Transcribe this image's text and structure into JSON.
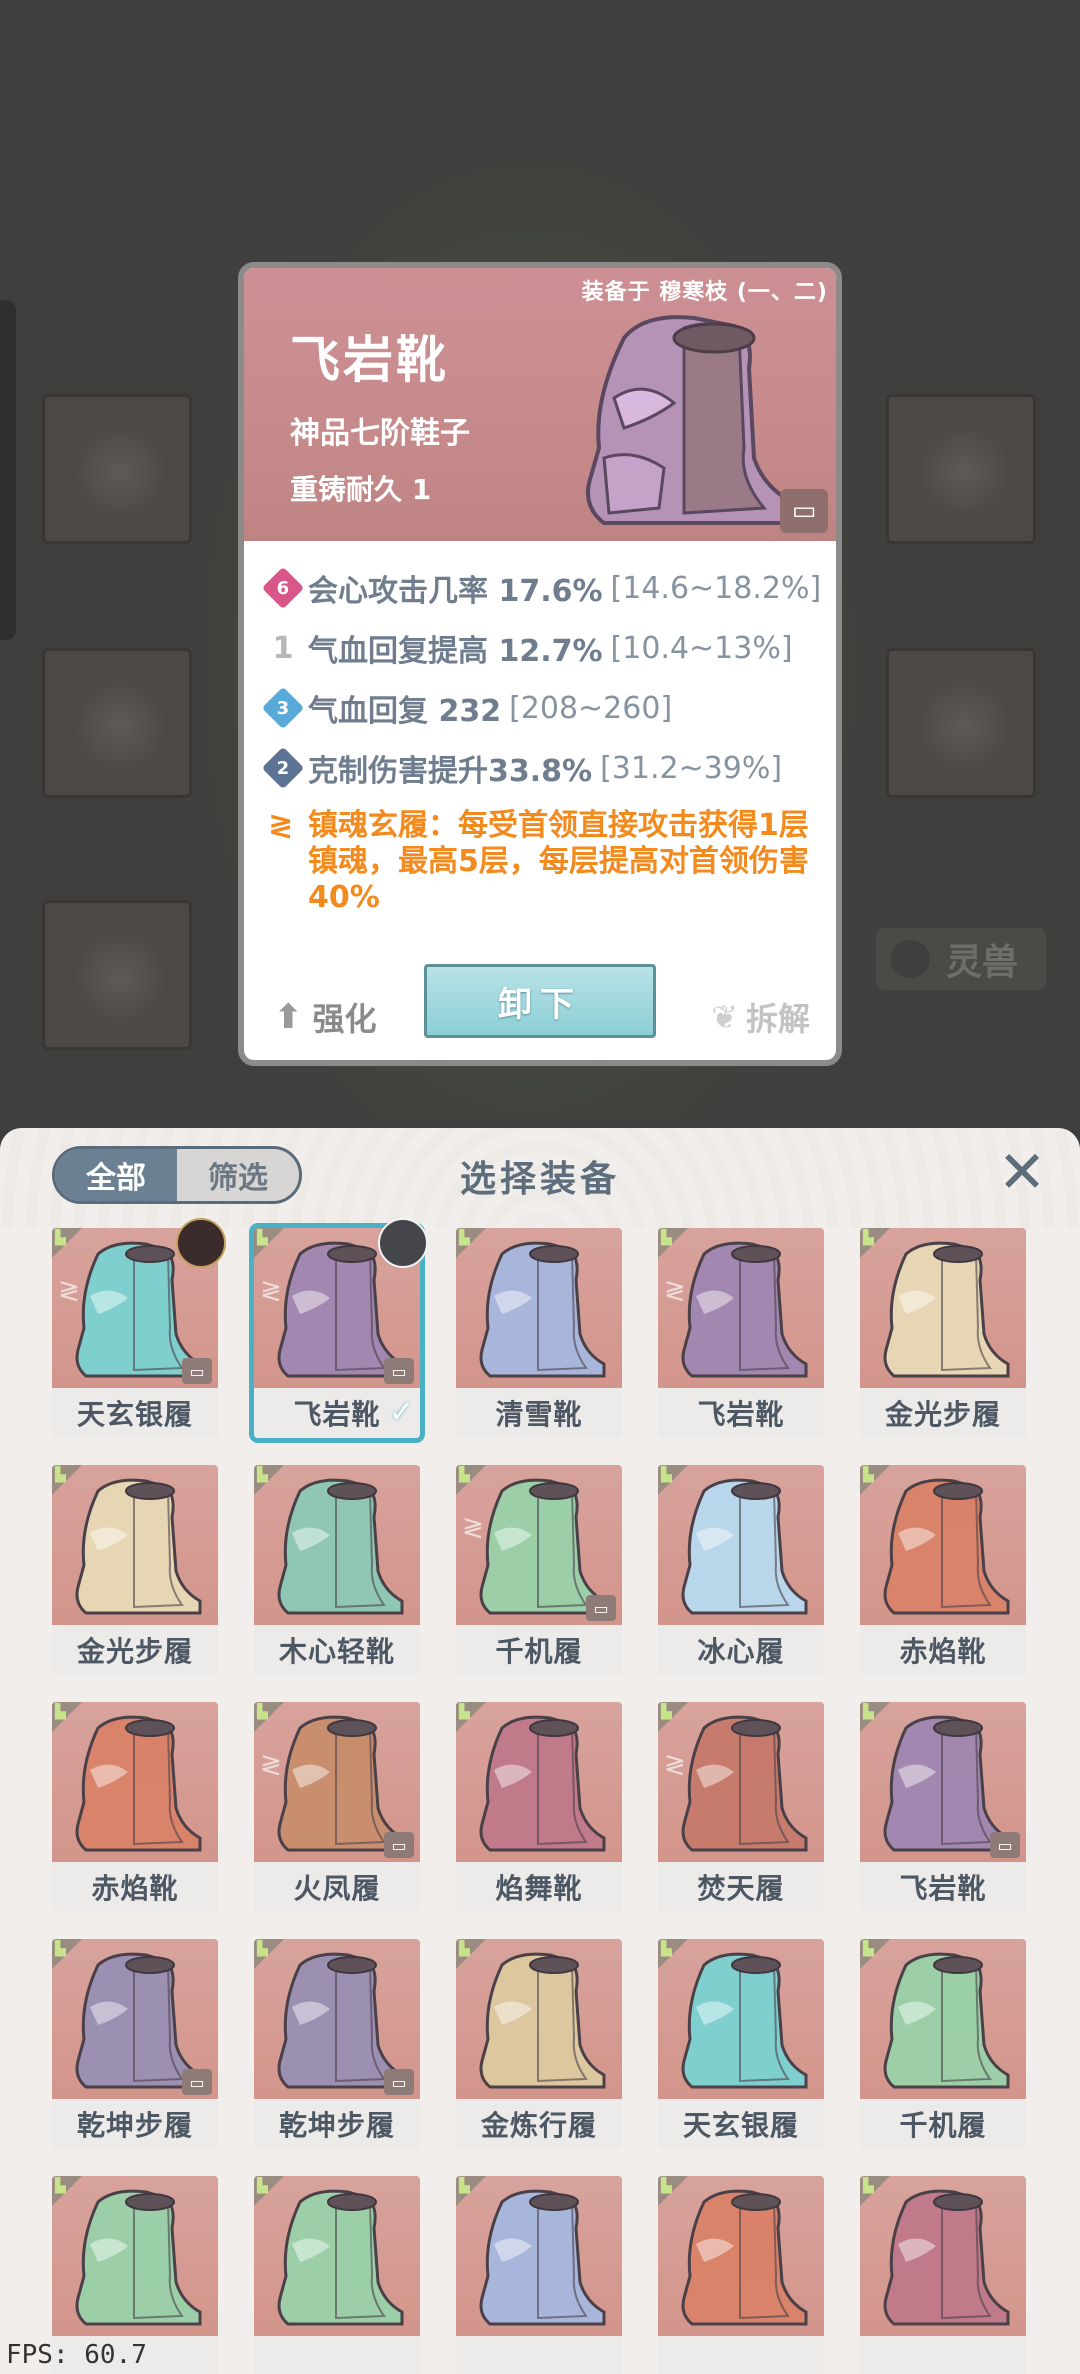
{
  "detail": {
    "equipped_by": "装备于 穆寒枝 (一、二)",
    "name": "飞岩靴",
    "grade": "神品七阶鞋子",
    "durability": "重铸耐久 1",
    "stats": [
      {
        "badge": "6",
        "gem": "pink",
        "label": "会心攻击几率 17.6%",
        "range": "[14.6~18.2%]"
      },
      {
        "badge": "1",
        "gem": "flame",
        "label": "气血回复提高 12.7%",
        "range": "[10.4~13%]"
      },
      {
        "badge": "3",
        "gem": "blue",
        "label": "气血回复 232",
        "range": "[208~260]"
      },
      {
        "badge": "2",
        "gem": "navy",
        "label": "克制伤害提升33.8%",
        "range": "[31.2~39%]"
      }
    ],
    "special": "镇魂玄履：每受首领直接攻击获得1层镇魂，最高5层，每层提高对首领伤害40%",
    "actions": {
      "upgrade": "强化",
      "remove": "卸下",
      "dismantle": "拆解"
    }
  },
  "background": {
    "pet_tab": "灵兽"
  },
  "panel": {
    "title": "选择装备",
    "filters": {
      "all": "全部",
      "filter": "筛选"
    },
    "items": [
      {
        "name": "天玄银履",
        "color": "#7fcfcf",
        "lock": true,
        "dash": true,
        "portrait": "f"
      },
      {
        "name": "飞岩靴",
        "color": "#a287b0",
        "lock": true,
        "dash": true,
        "portrait": "m",
        "selected": true
      },
      {
        "name": "清雪靴",
        "color": "#a9b6db",
        "lock": false,
        "dash": false
      },
      {
        "name": "飞岩靴",
        "color": "#a287b0",
        "lock": false,
        "dash": true
      },
      {
        "name": "金光步履",
        "color": "#e6d6b4",
        "lock": false,
        "dash": false
      },
      {
        "name": "金光步履",
        "color": "#e6d6b4",
        "lock": false,
        "dash": false
      },
      {
        "name": "木心轻靴",
        "color": "#8fc7b4",
        "lock": false,
        "dash": false
      },
      {
        "name": "千机履",
        "color": "#9ccfa8",
        "lock": true,
        "dash": true
      },
      {
        "name": "冰心履",
        "color": "#b9d6ea",
        "lock": false,
        "dash": false
      },
      {
        "name": "赤焰靴",
        "color": "#d9836a",
        "lock": false,
        "dash": false
      },
      {
        "name": "赤焰靴",
        "color": "#d9836a",
        "lock": false,
        "dash": false
      },
      {
        "name": "火凤履",
        "color": "#c98e6d",
        "lock": true,
        "dash": true
      },
      {
        "name": "焰舞靴",
        "color": "#c07a8a",
        "lock": false,
        "dash": false
      },
      {
        "name": "焚天履",
        "color": "#c77b6c",
        "lock": false,
        "dash": true
      },
      {
        "name": "飞岩靴",
        "color": "#a287b0",
        "lock": true,
        "dash": false
      },
      {
        "name": "乾坤步履",
        "color": "#9b8fb2",
        "lock": true,
        "dash": false
      },
      {
        "name": "乾坤步履",
        "color": "#9b8fb2",
        "lock": true,
        "dash": false
      },
      {
        "name": "金炼行履",
        "color": "#ddc79e",
        "lock": false,
        "dash": false
      },
      {
        "name": "天玄银履",
        "color": "#7fcfcf",
        "lock": false,
        "dash": false
      },
      {
        "name": "千机履",
        "color": "#9ccfa8",
        "lock": false,
        "dash": false
      },
      {
        "name": "",
        "color": "#9ccfa8",
        "lock": false,
        "dash": false
      },
      {
        "name": "",
        "color": "#9ccfa8",
        "lock": false,
        "dash": false
      },
      {
        "name": "",
        "color": "#a9b6db",
        "lock": false,
        "dash": false
      },
      {
        "name": "",
        "color": "#d9836a",
        "lock": false,
        "dash": false
      },
      {
        "name": "",
        "color": "#c07a8a",
        "lock": false,
        "dash": false
      }
    ]
  },
  "fps": "FPS: 60.7"
}
